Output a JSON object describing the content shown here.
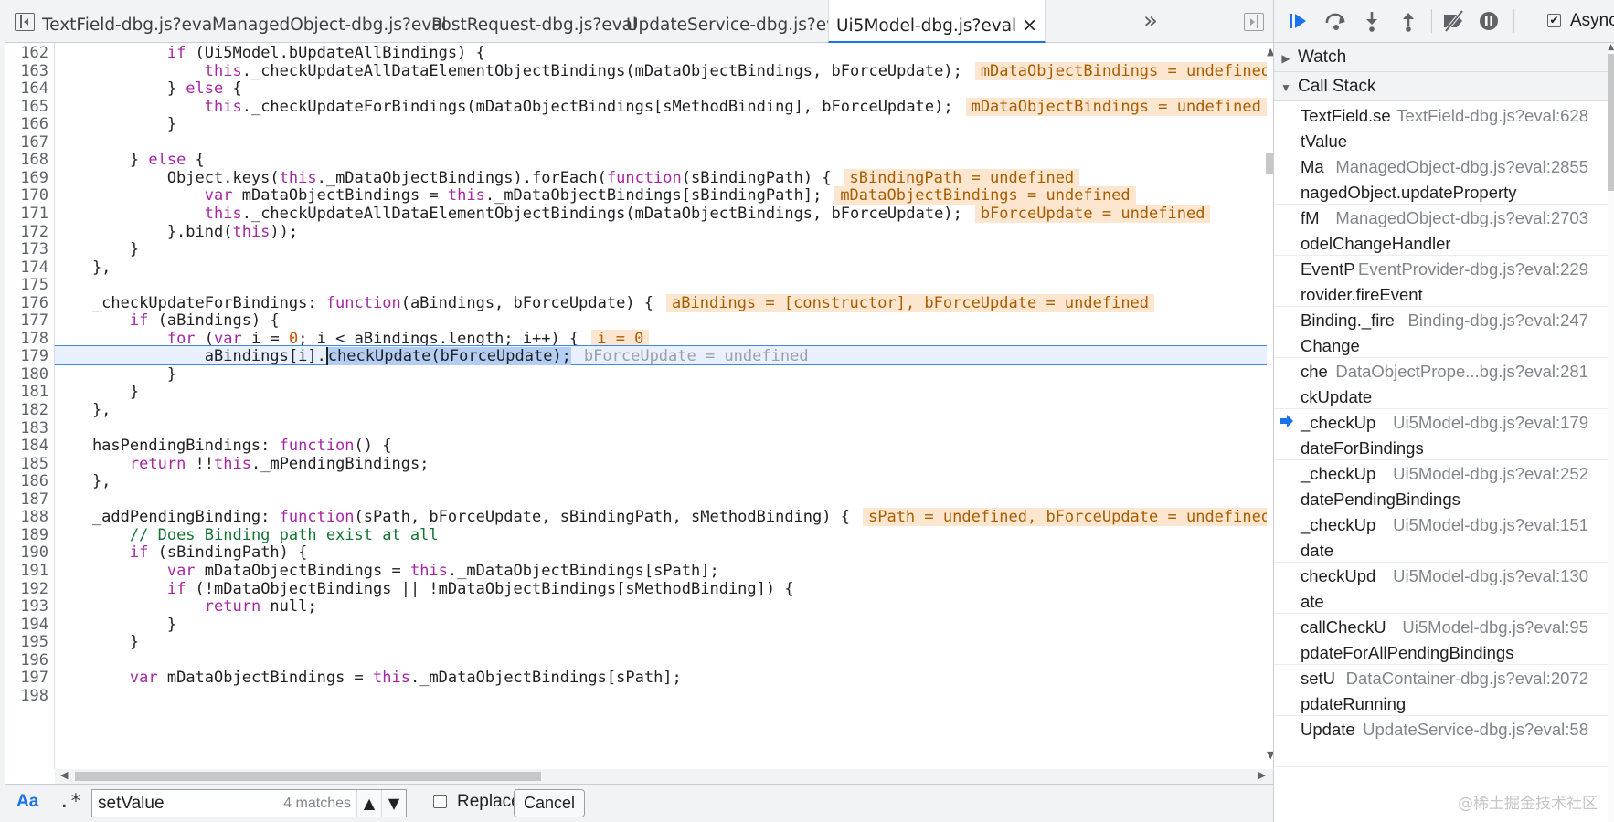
{
  "tabs": [
    {
      "label": "TextField-dbg.js?eval",
      "active": false
    },
    {
      "label": "ManagedObject-dbg.js?eval",
      "active": false
    },
    {
      "label": "PostRequest-dbg.js?eval",
      "active": false
    },
    {
      "label": "UpdateService-dbg.js?eval",
      "active": false
    },
    {
      "label": "Ui5Model-dbg.js?eval",
      "active": true
    }
  ],
  "tab_overflow": "»",
  "tab_close": "×",
  "code": {
    "lines": [
      {
        "n": "162",
        "segs": [
          [
            "            ",
            ""
          ],
          [
            "if",
            "kw"
          ],
          [
            " (Ui5Model.bUpdateAllBindings) {",
            ""
          ]
        ]
      },
      {
        "n": "163",
        "segs": [
          [
            "                ",
            ""
          ],
          [
            "this",
            "th"
          ],
          [
            "._checkUpdateAllDataElementObjectBindings(mDataObjectBindings, bForceUpdate);",
            ""
          ],
          [
            "mDataObjectBindings = undefined",
            "iv"
          ]
        ]
      },
      {
        "n": "164",
        "segs": [
          [
            "            } ",
            ""
          ],
          [
            "else",
            "kw"
          ],
          [
            " {",
            ""
          ]
        ]
      },
      {
        "n": "165",
        "segs": [
          [
            "                ",
            ""
          ],
          [
            "this",
            "th"
          ],
          [
            "._checkUpdateForBindings(mDataObjectBindings[sMethodBinding], bForceUpdate);",
            ""
          ],
          [
            "mDataObjectBindings = undefined",
            "iv"
          ]
        ]
      },
      {
        "n": "166",
        "segs": [
          [
            "            }",
            ""
          ]
        ]
      },
      {
        "n": "167",
        "segs": [
          [
            "",
            ""
          ]
        ]
      },
      {
        "n": "168",
        "segs": [
          [
            "        } ",
            ""
          ],
          [
            "else",
            "kw"
          ],
          [
            " {",
            ""
          ]
        ]
      },
      {
        "n": "169",
        "segs": [
          [
            "            Object.keys(",
            ""
          ],
          [
            "this",
            "th"
          ],
          [
            "._mDataObjectBindings).forEach(",
            ""
          ],
          [
            "function",
            "kw"
          ],
          [
            "(sBindingPath) {",
            ""
          ],
          [
            "sBindingPath = undefined",
            "iv"
          ]
        ]
      },
      {
        "n": "170",
        "segs": [
          [
            "                ",
            ""
          ],
          [
            "var",
            "kw"
          ],
          [
            " mDataObjectBindings = ",
            ""
          ],
          [
            "this",
            "th"
          ],
          [
            "._mDataObjectBindings[sBindingPath];",
            ""
          ],
          [
            "mDataObjectBindings = undefined",
            "iv"
          ]
        ]
      },
      {
        "n": "171",
        "segs": [
          [
            "                ",
            ""
          ],
          [
            "this",
            "th"
          ],
          [
            "._checkUpdateAllDataElementObjectBindings(mDataObjectBindings, bForceUpdate);",
            ""
          ],
          [
            "bForceUpdate = undefined",
            "iv"
          ]
        ]
      },
      {
        "n": "172",
        "segs": [
          [
            "            }.bind(",
            ""
          ],
          [
            "this",
            "th"
          ],
          [
            "));",
            ""
          ]
        ]
      },
      {
        "n": "173",
        "segs": [
          [
            "        }",
            ""
          ]
        ]
      },
      {
        "n": "174",
        "segs": [
          [
            "    },",
            ""
          ]
        ]
      },
      {
        "n": "175",
        "segs": [
          [
            "",
            ""
          ]
        ]
      },
      {
        "n": "176",
        "segs": [
          [
            "    _checkUpdateForBindings: ",
            ""
          ],
          [
            "function",
            "kw"
          ],
          [
            "(aBindings, bForceUpdate) {",
            ""
          ],
          [
            "aBindings = [constructor], bForceUpdate = undefined",
            "iv"
          ]
        ]
      },
      {
        "n": "177",
        "segs": [
          [
            "        ",
            ""
          ],
          [
            "if",
            "kw"
          ],
          [
            " (aBindings) {",
            ""
          ]
        ]
      },
      {
        "n": "178",
        "segs": [
          [
            "            ",
            ""
          ],
          [
            "for",
            "kw"
          ],
          [
            " (",
            ""
          ],
          [
            "var",
            "kw"
          ],
          [
            " i = ",
            ""
          ],
          [
            "0",
            "num"
          ],
          [
            "; i < aBindings.length; i++) {",
            ""
          ],
          [
            "i = 0",
            "iv"
          ]
        ]
      },
      {
        "n": "179",
        "current": true,
        "segs": [
          [
            "                aBindings[i].",
            ""
          ],
          [
            "checkUpdate(bForceUpdate);",
            "sel"
          ],
          [
            "bForceUpdate = undefined",
            "iv-plain"
          ]
        ]
      },
      {
        "n": "180",
        "segs": [
          [
            "            }",
            ""
          ]
        ]
      },
      {
        "n": "181",
        "segs": [
          [
            "        }",
            ""
          ]
        ]
      },
      {
        "n": "182",
        "segs": [
          [
            "    },",
            ""
          ]
        ]
      },
      {
        "n": "183",
        "segs": [
          [
            "",
            ""
          ]
        ]
      },
      {
        "n": "184",
        "segs": [
          [
            "    hasPendingBindings: ",
            ""
          ],
          [
            "function",
            "kw"
          ],
          [
            "() {",
            ""
          ]
        ]
      },
      {
        "n": "185",
        "segs": [
          [
            "        ",
            ""
          ],
          [
            "return",
            "kw"
          ],
          [
            " !!",
            ""
          ],
          [
            "this",
            "th"
          ],
          [
            "._mPendingBindings;",
            ""
          ]
        ]
      },
      {
        "n": "186",
        "segs": [
          [
            "    },",
            ""
          ]
        ]
      },
      {
        "n": "187",
        "segs": [
          [
            "",
            ""
          ]
        ]
      },
      {
        "n": "188",
        "segs": [
          [
            "    _addPendingBinding: ",
            ""
          ],
          [
            "function",
            "kw"
          ],
          [
            "(sPath, bForceUpdate, sBindingPath, sMethodBinding) {",
            ""
          ],
          [
            "sPath = undefined, bForceUpdate = undefined",
            "iv"
          ]
        ]
      },
      {
        "n": "189",
        "segs": [
          [
            "        ",
            ""
          ],
          [
            "// Does Binding path exist at all",
            "cm"
          ]
        ]
      },
      {
        "n": "190",
        "segs": [
          [
            "        ",
            ""
          ],
          [
            "if",
            "kw"
          ],
          [
            " (sBindingPath) {",
            ""
          ]
        ]
      },
      {
        "n": "191",
        "segs": [
          [
            "            ",
            ""
          ],
          [
            "var",
            "kw"
          ],
          [
            " mDataObjectBindings = ",
            ""
          ],
          [
            "this",
            "th"
          ],
          [
            "._mDataObjectBindings[sPath];",
            ""
          ]
        ]
      },
      {
        "n": "192",
        "segs": [
          [
            "            ",
            ""
          ],
          [
            "if",
            "kw"
          ],
          [
            " (!mDataObjectBindings || !mDataObjectBindings[sMethodBinding]) {",
            ""
          ]
        ]
      },
      {
        "n": "193",
        "segs": [
          [
            "                ",
            ""
          ],
          [
            "return",
            "kw"
          ],
          [
            " null;",
            ""
          ]
        ]
      },
      {
        "n": "194",
        "segs": [
          [
            "            }",
            ""
          ]
        ]
      },
      {
        "n": "195",
        "segs": [
          [
            "        }",
            ""
          ]
        ]
      },
      {
        "n": "196",
        "segs": [
          [
            "",
            ""
          ]
        ]
      },
      {
        "n": "197",
        "segs": [
          [
            "        ",
            ""
          ],
          [
            "var",
            "kw"
          ],
          [
            " mDataObjectBindings = ",
            ""
          ],
          [
            "this",
            "th"
          ],
          [
            "._mDataObjectBindings[sPath];",
            ""
          ]
        ]
      },
      {
        "n": "198",
        "segs": [
          [
            "",
            ""
          ]
        ]
      }
    ]
  },
  "search": {
    "case_label": "Aa",
    "regex_label": ".*",
    "value": "setValue",
    "match_count": "4 matches",
    "prev": "▲",
    "next": "▼",
    "replace_label": "Replace",
    "cancel_label": "Cancel"
  },
  "debugger": {
    "async_label": "Async",
    "watch_label": "Watch",
    "callstack_label": "Call Stack",
    "frames": [
      {
        "fn1": "TextField.se",
        "fn2": "tValue",
        "loc": "TextField-dbg.js?eval:628",
        "current": false
      },
      {
        "fn1": "Ma",
        "fn2": "nagedObject.updateProperty",
        "loc": "ManagedObject-dbg.js?eval:2855",
        "current": false
      },
      {
        "fn1": "fM",
        "fn2": "odelChangeHandler",
        "loc": "ManagedObject-dbg.js?eval:2703",
        "current": false
      },
      {
        "fn1": "EventP",
        "fn2": "rovider.fireEvent",
        "loc": "EventProvider-dbg.js?eval:229",
        "current": false
      },
      {
        "fn1": "Binding._fire",
        "fn2": "Change",
        "loc": "Binding-dbg.js?eval:247",
        "current": false
      },
      {
        "fn1": "che",
        "fn2": "ckUpdate",
        "loc": "DataObjectPrope...bg.js?eval:281",
        "current": false
      },
      {
        "fn1": "_checkUp",
        "fn2": "dateForBindings",
        "loc": "Ui5Model-dbg.js?eval:179",
        "current": true
      },
      {
        "fn1": "_checkUp",
        "fn2": "datePendingBindings",
        "loc": "Ui5Model-dbg.js?eval:252",
        "current": false
      },
      {
        "fn1": "_checkUp",
        "fn2": "date",
        "loc": "Ui5Model-dbg.js?eval:151",
        "current": false
      },
      {
        "fn1": "checkUpd",
        "fn2": "ate",
        "loc": "Ui5Model-dbg.js?eval:130",
        "current": false
      },
      {
        "fn1": "callCheckU",
        "fn2": "pdateForAllPendingBindings",
        "loc": "Ui5Model-dbg.js?eval:95",
        "current": false
      },
      {
        "fn1": "setU",
        "fn2": "pdateRunning",
        "loc": "DataContainer-dbg.js?eval:2072",
        "current": false
      },
      {
        "fn1": "Update",
        "fn2": "",
        "loc": "UpdateService-dbg.js?eval:58",
        "current": false
      }
    ]
  },
  "watermark": "@稀土掘金技术社区",
  "colors": {
    "accent": "#1a73e8",
    "keyword": "#a626a4",
    "inline_value_bg": "#fde6cf",
    "current_line_bg": "#e8f0fe"
  }
}
